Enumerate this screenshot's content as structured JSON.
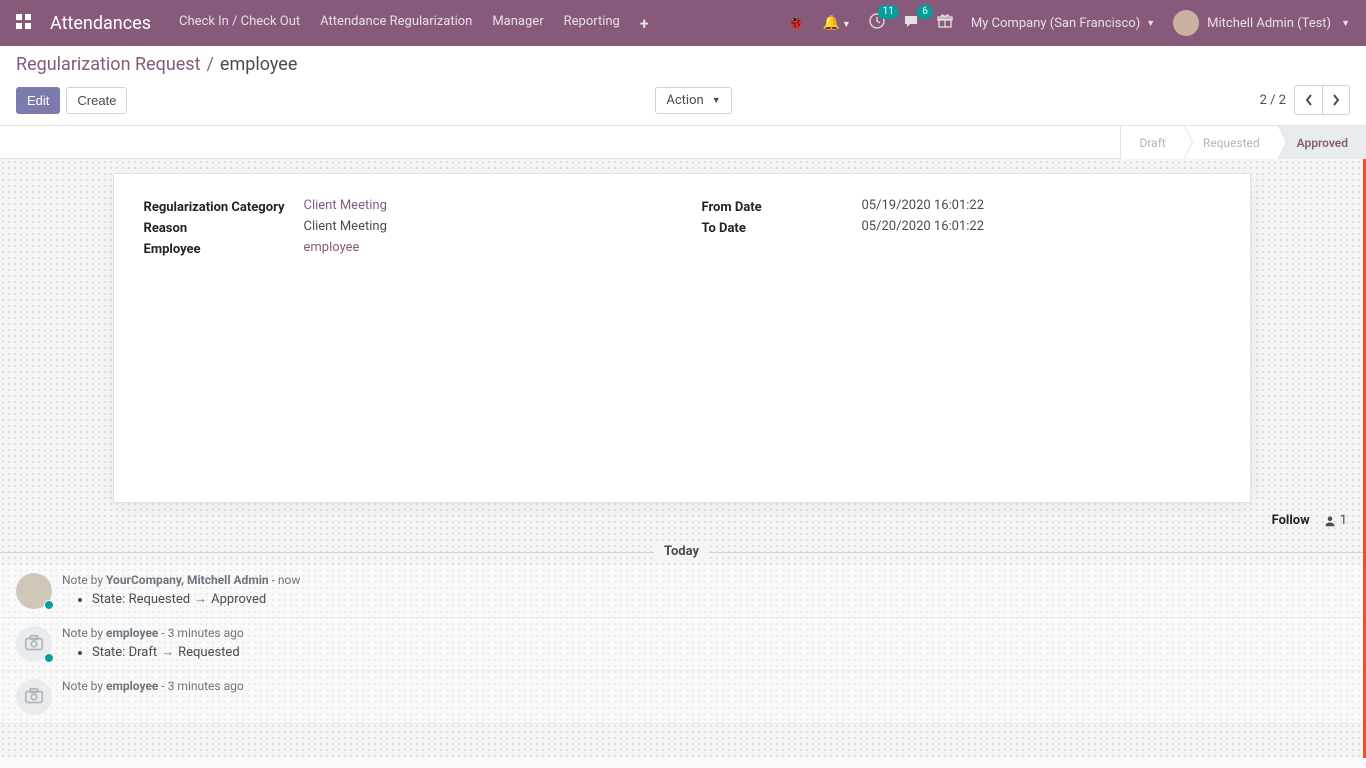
{
  "topnav": {
    "brand": "Attendances",
    "links": [
      "Check In / Check Out",
      "Attendance Regularization",
      "Manager",
      "Reporting"
    ],
    "badges": {
      "activities": "11",
      "messages": "6"
    },
    "company": "My Company (San Francisco)",
    "user": "Mitchell Admin (Test)"
  },
  "breadcrumb": {
    "root": "Regularization Request",
    "current": "employee"
  },
  "buttons": {
    "edit": "Edit",
    "create": "Create",
    "action": "Action"
  },
  "pager": {
    "text": "2 / 2"
  },
  "status": {
    "draft": "Draft",
    "requested": "Requested",
    "approved": "Approved"
  },
  "form": {
    "labels": {
      "category": "Regularization Category",
      "reason": "Reason",
      "employee": "Employee",
      "from_date": "From Date",
      "to_date": "To Date"
    },
    "values": {
      "category": "Client Meeting",
      "reason": "Client Meeting",
      "employee": "employee",
      "from_date": "05/19/2020 16:01:22",
      "to_date": "05/20/2020 16:01:22"
    }
  },
  "chatter": {
    "follow": "Follow",
    "follower_count": "1",
    "date_separator": "Today",
    "note_prefix": "Note by ",
    "msgs": [
      {
        "author": "YourCompany, Mitchell Admin",
        "time": "now",
        "state_label": "State:",
        "from": "Requested",
        "to": "Approved"
      },
      {
        "author": "employee",
        "time": "3 minutes ago",
        "state_label": "State:",
        "from": "Draft",
        "to": "Requested"
      },
      {
        "author": "employee",
        "time": "3 minutes ago"
      }
    ]
  }
}
